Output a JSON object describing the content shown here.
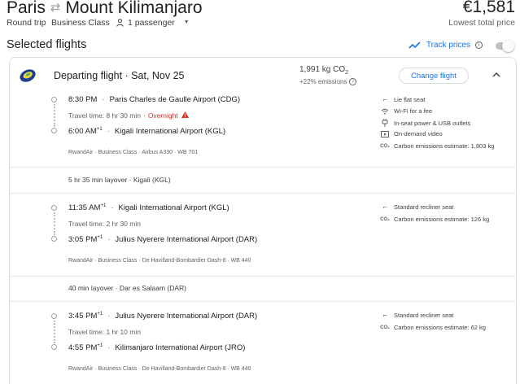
{
  "header": {
    "origin": "Paris",
    "destination": "Mount Kilimanjaro",
    "trip_type": "Round trip",
    "cabin": "Business Class",
    "passengers": "1 passenger",
    "price": "€1,581",
    "price_note": "Lowest total price"
  },
  "section": {
    "title": "Selected flights",
    "track_label": "Track prices",
    "track_enabled": false
  },
  "departing": {
    "label": "Departing flight · Sat, Nov 25",
    "co2_value": "1,991 kg CO",
    "co2_sub": "2",
    "emissions_delta": "+22% emissions",
    "change_button": "Change flight"
  },
  "segments": [
    {
      "dep_time": "8:30 PM",
      "dep_airport": "Paris Charles de Gaulle Airport (CDG)",
      "travel_time": "Travel time: 8 hr 30 min",
      "overnight": "Overnight",
      "arr_time": "6:00 AM",
      "arr_plus": "+1",
      "arr_airport": "Kigali International Airport (KGL)",
      "meta": "RwandAir · Business Class · Airbus A330 · WB 701",
      "amenities": [
        {
          "icon": "seat-icon",
          "text": "Lie flat seat"
        },
        {
          "icon": "wifi-icon",
          "text": "Wi-Fi for a fee"
        },
        {
          "icon": "power-icon",
          "text": "In-seat power & USB outlets"
        },
        {
          "icon": "video-icon",
          "text": "On-demand video"
        },
        {
          "icon": "co2-icon",
          "text": "Carbon emissions estimate: 1,803 kg"
        }
      ]
    },
    {
      "dep_time": "11:35 AM",
      "dep_plus": "+1",
      "dep_airport": "Kigali International Airport (KGL)",
      "travel_time": "Travel time: 2 hr 30 min",
      "arr_time": "3:05 PM",
      "arr_plus": "+1",
      "arr_airport": "Julius Nyerere International Airport (DAR)",
      "meta": "RwandAir · Business Class · De Havilland-Bombardier Dash-8 · WB 440",
      "amenities": [
        {
          "icon": "seat-icon",
          "text": "Standard recliner seat"
        },
        {
          "icon": "co2-icon",
          "text": "Carbon emissions estimate: 126 kg"
        }
      ]
    },
    {
      "dep_time": "3:45 PM",
      "dep_plus": "+1",
      "dep_airport": "Julius Nyerere International Airport (DAR)",
      "travel_time": "Travel time: 1 hr 10 min",
      "arr_time": "4:55 PM",
      "arr_plus": "+1",
      "arr_airport": "Kilimanjaro International Airport (JRO)",
      "meta": "RwandAir · Business Class · De Havilland-Bombardier Dash-8 · WB 440",
      "amenities": [
        {
          "icon": "seat-icon",
          "text": "Standard recliner seat"
        },
        {
          "icon": "co2-icon",
          "text": "Carbon emissions estimate: 62 kg"
        }
      ]
    }
  ],
  "layovers": [
    "5 hr 35 min layover · Kigali (KGL)",
    "40 min layover · Dar es Salaam (DAR)"
  ],
  "colors": {
    "accent": "#1a73e8",
    "warning": "#d93025",
    "border": "#dadce0"
  }
}
